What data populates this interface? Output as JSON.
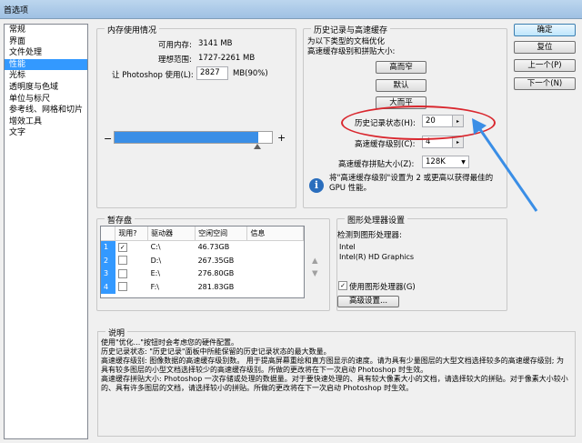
{
  "window": {
    "title": "首选项"
  },
  "sidebar": {
    "items": [
      {
        "label": "常规"
      },
      {
        "label": "界面"
      },
      {
        "label": "文件处理"
      },
      {
        "label": "性能"
      },
      {
        "label": "光标"
      },
      {
        "label": "透明度与色域"
      },
      {
        "label": "单位与标尺"
      },
      {
        "label": "参考线、网格和切片"
      },
      {
        "label": "增效工具"
      },
      {
        "label": "文字"
      }
    ],
    "selected": "性能"
  },
  "buttons": {
    "ok": "确定",
    "reset": "复位",
    "prev": "上一个(P)",
    "next": "下一个(N)"
  },
  "memory": {
    "title": "内存使用情况",
    "available_label": "可用内存:",
    "available_value": "3141 MB",
    "ideal_label": "理想范围:",
    "ideal_value": "1727-2261 MB",
    "use_label": "让 Photoshop 使用(L):",
    "use_value": "2827",
    "use_suffix": "MB(90%)",
    "minus": "−",
    "plus": "+",
    "slider_fraction": 0.9
  },
  "history": {
    "title": "历史记录与高速缓存",
    "desc": "为以下类型的文档优化\n高速缓存级别和拼贴大小:",
    "btn_tall": "高而窄",
    "btn_default": "默认",
    "btn_big": "大而平",
    "states_label": "历史记录状态(H):",
    "states_value": "20",
    "levels_label": "高速缓存级别(C):",
    "levels_value": "4",
    "tile_label": "高速缓存拼贴大小(Z):",
    "tile_value": "128K",
    "info_icon": "i",
    "info_text": "将\"高速缓存级别\"设置为 2 或更高以获得最佳的\nGPU 性能。"
  },
  "scratch": {
    "title": "暂存盘",
    "columns": [
      "",
      "现用?",
      "驱动器",
      "空闲空间",
      "信息"
    ],
    "rows": [
      {
        "num": "1",
        "active": "✓",
        "drive": "C:\\",
        "free": "46.73GB",
        "info": ""
      },
      {
        "num": "2",
        "active": "",
        "drive": "D:\\",
        "free": "267.35GB",
        "info": ""
      },
      {
        "num": "3",
        "active": "",
        "drive": "E:\\",
        "free": "276.80GB",
        "info": ""
      },
      {
        "num": "4",
        "active": "",
        "drive": "F:\\",
        "free": "281.83GB",
        "info": ""
      }
    ],
    "up": "▲",
    "down": "▼"
  },
  "gpu": {
    "title": "图形处理器设置",
    "detected_label": "检测到图形处理器:",
    "gpu_line1": "Intel",
    "gpu_line2": "Intel(R) HD Graphics",
    "use_gpu_label": "使用图形处理器(G)",
    "use_gpu_check": "✓",
    "advanced": "高级设置..."
  },
  "notes": {
    "title": "说明",
    "text": "使用\"优化...\"按钮时会考虑您的硬件配置。\n历史记录状态: \"历史记录\"面板中所能保留的历史记录状态的最大数量。\n高速缓存级别: 图像数据的高速缓存级别数。 用于提高屏幕重绘和直方图显示的速度。请为具有少量图层的大型文档选择较多的高速缓存级别; 为具有较多图层的小型文档选择较少的高速缓存级别。所做的更改将在下一次启动 Photoshop 时生效。\n高速缓存拼贴大小: Photoshop 一次存储或处理的数据量。对于要快速处理的、具有较大像素大小的文档，请选择较大的拼贴。对于像素大小较小的、具有许多图层的文档，请选择较小的拼贴。所做的更改将在下一次启动 Photoshop 时生效。"
  },
  "colors": {
    "selection": "#3399ff",
    "slider_fill": "#3a8ee6",
    "callout": "#d9272e",
    "arrow": "#3a8ee6"
  }
}
